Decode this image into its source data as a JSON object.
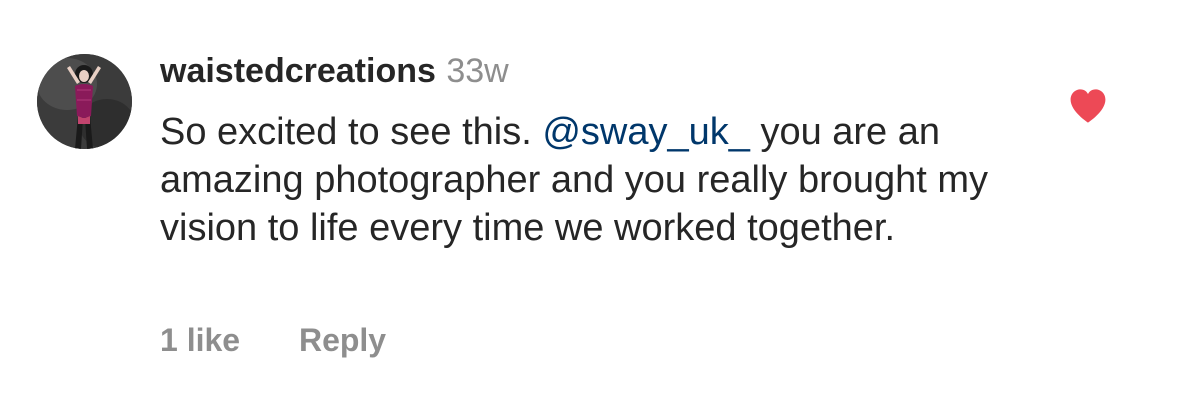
{
  "comment": {
    "username": "waistedcreations",
    "time": "33w",
    "text_before": "So excited to see this. ",
    "mention": "@sway_uk_",
    "text_after": " you are an amazing photographer and you really brought my vision to life every time we worked together.",
    "likes": "1 like",
    "reply_label": "Reply",
    "liked": true
  },
  "icons": {
    "like": "heart-icon",
    "avatar": "avatar-image"
  },
  "colors": {
    "heart": "#ed4956",
    "mention": "#00376b",
    "muted": "#8e8e8e",
    "text": "#262626"
  }
}
